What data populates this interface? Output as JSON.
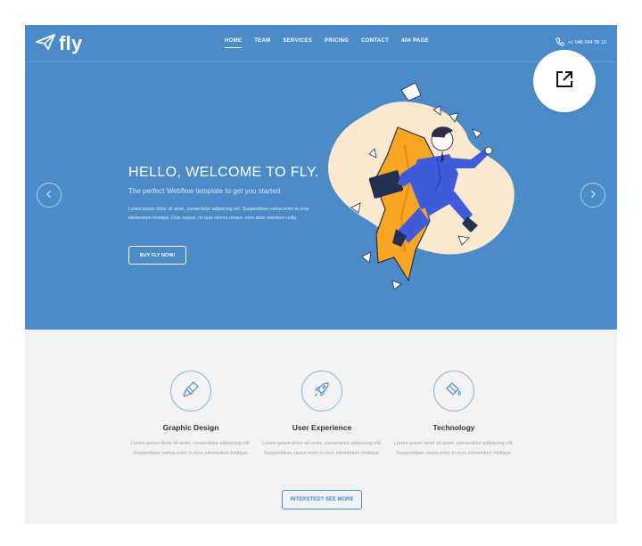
{
  "brand": {
    "name": "fly"
  },
  "nav": {
    "items": [
      {
        "label": "HOME"
      },
      {
        "label": "TEAM"
      },
      {
        "label": "SERVICES"
      },
      {
        "label": "PRICING"
      },
      {
        "label": "CONTACT"
      },
      {
        "label": "404 PAGE"
      }
    ],
    "active_index": 0,
    "phone": "+1 046 044 39 12"
  },
  "hero": {
    "title": "HELLO, WELCOME TO FLY.",
    "subtitle": "The perfect Webflow template to get you started",
    "body": "Lorem ipsum dolor sit amet, consectetur adipiscing elit. Suspendisse varius enim in eros elementum tristique. Duis cursus, mi quis viverra ornare, eros dolor interdum nulla.",
    "cta_label": "BUY FLY NOW!",
    "prev_icon": "chevron-left-icon",
    "next_icon": "chevron-right-icon"
  },
  "features": {
    "items": [
      {
        "title": "Graphic Design",
        "icon": "paintbrush-icon",
        "description": "Lorem ipsum dolor sit amet, consectetur adipiscing elit. Suspendisse varius enim in eros elementum tristique."
      },
      {
        "title": "User Experience",
        "icon": "rocket-icon",
        "description": "Lorem ipsum dolor sit amet, consectetur adipiscing elit. Suspendisse varius enim in eros elementum tristique."
      },
      {
        "title": "Technology",
        "icon": "paint-bucket-icon",
        "description": "Lorem ipsum dolor sit amet, consectetur adipiscing elit. Suspendisse varius enim in eros elementum tristique."
      }
    ],
    "more_label": "INTERSTED? SEE MORE"
  },
  "overlay": {
    "open_icon": "open-in-new-icon"
  },
  "colors": {
    "hero_blue": "#4a8bc8",
    "illustration_blob": "#fbe9cf",
    "accent_orange": "#f6a623",
    "suit_blue": "#3f5bd9",
    "section_gray": "#f2f2f2"
  }
}
